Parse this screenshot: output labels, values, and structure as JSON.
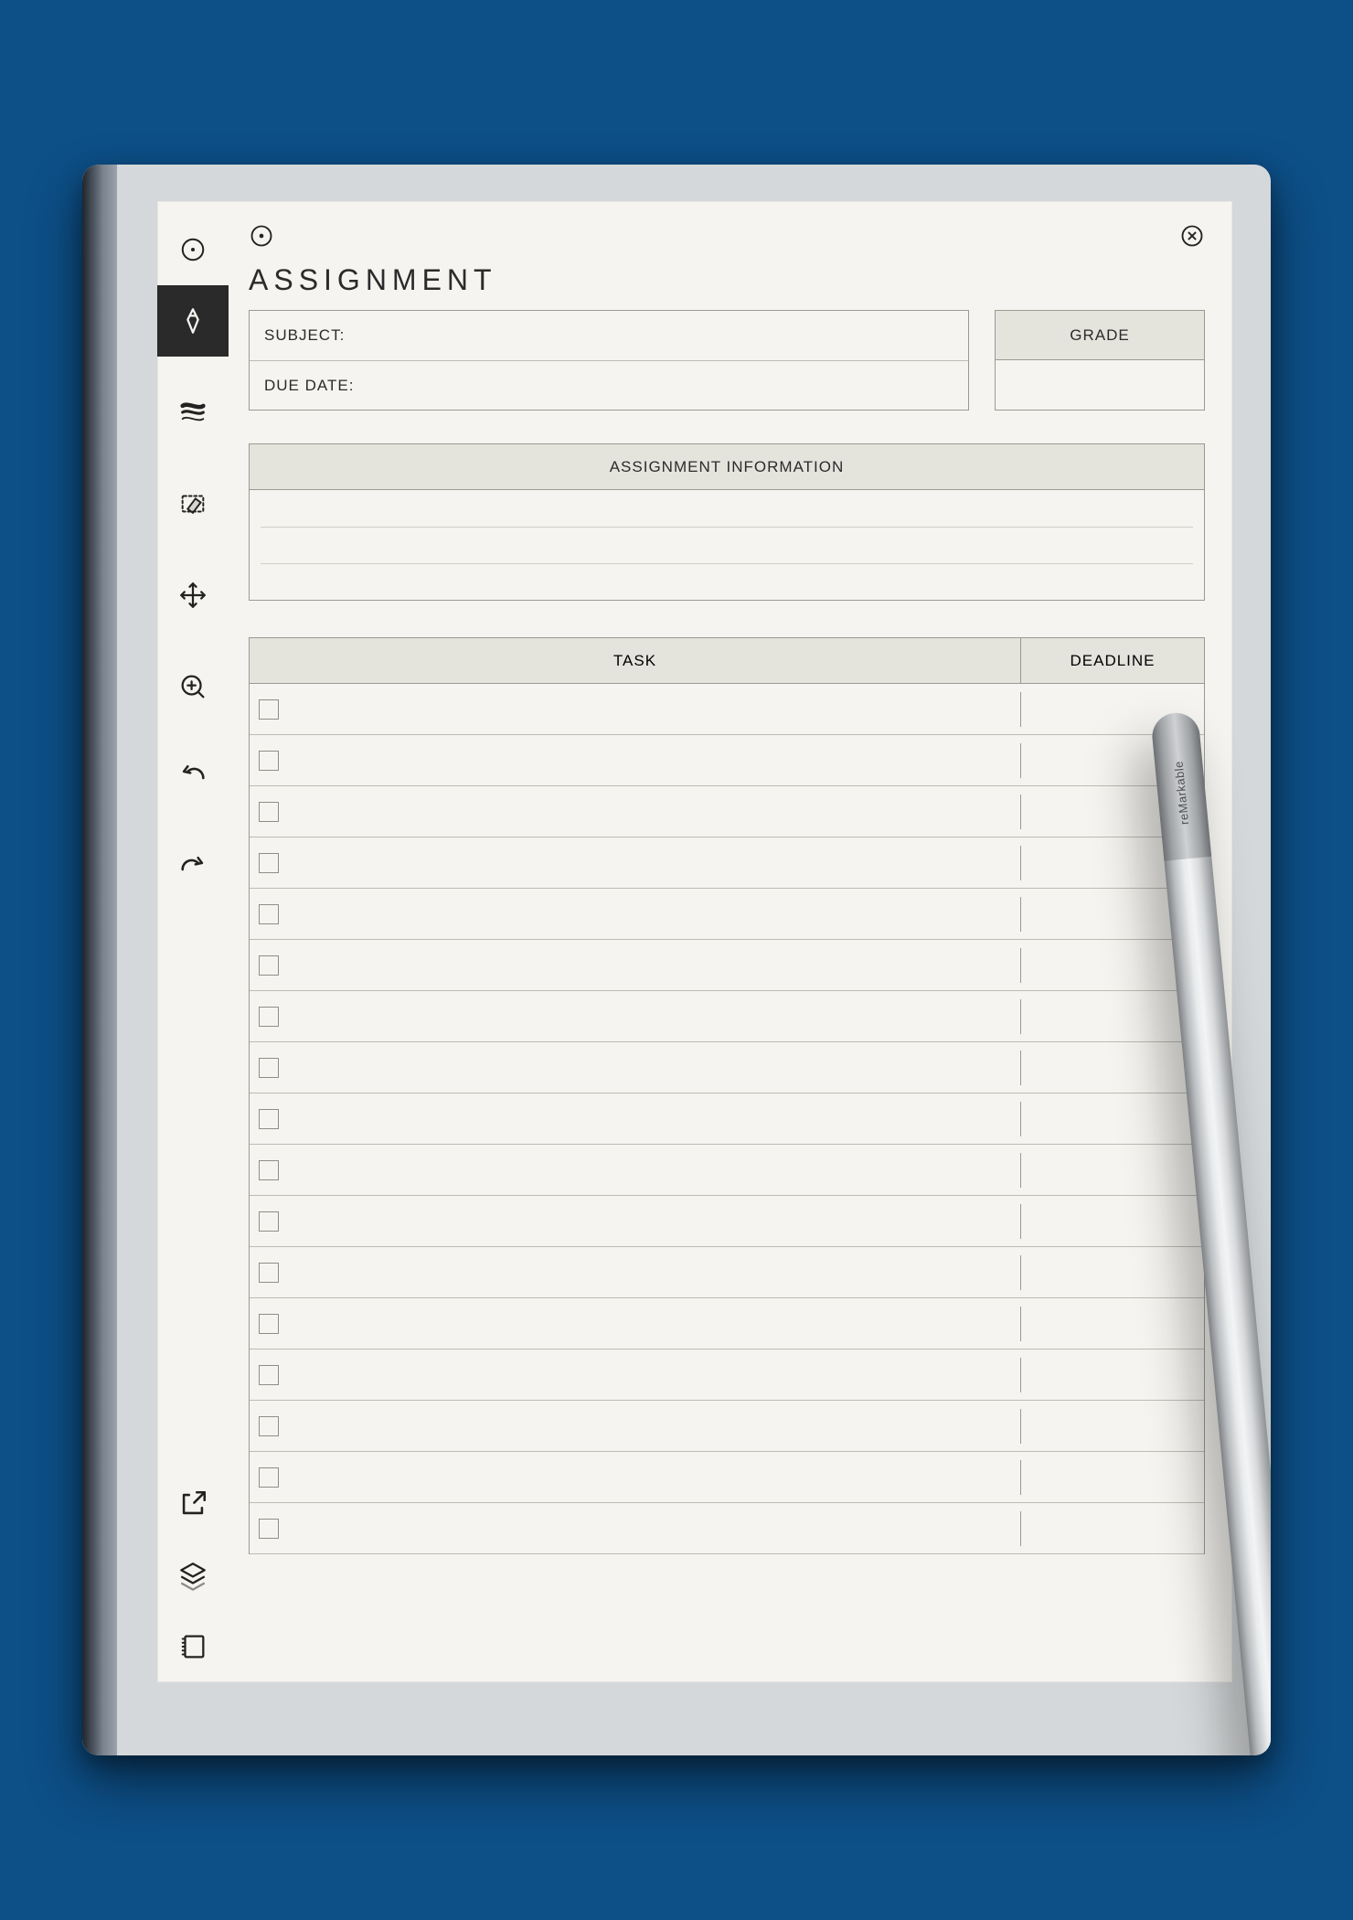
{
  "title": "ASSIGNMENT",
  "fields": {
    "subject_label": "SUBJECT:",
    "due_date_label": "DUE DATE:",
    "grade_label": "GRADE"
  },
  "info": {
    "header": "ASSIGNMENT INFORMATION"
  },
  "task_table": {
    "col_task": "TASK",
    "col_deadline": "DEADLINE",
    "row_count": 17
  },
  "pen": {
    "brand": "reMarkable"
  },
  "toolbar": {
    "items": [
      {
        "name": "menu-dot-icon",
        "active": false
      },
      {
        "name": "pen-tool-icon",
        "active": true
      },
      {
        "name": "stroke-width-icon",
        "active": false
      },
      {
        "name": "eraser-icon",
        "active": false
      },
      {
        "name": "move-icon",
        "active": false
      },
      {
        "name": "zoom-in-icon",
        "active": false
      },
      {
        "name": "undo-icon",
        "active": false
      },
      {
        "name": "redo-icon",
        "active": false
      }
    ],
    "bottom_items": [
      {
        "name": "share-icon"
      },
      {
        "name": "layers-icon"
      },
      {
        "name": "notebook-icon"
      }
    ]
  },
  "top_icons": {
    "left": "record-icon",
    "right": "close-icon"
  }
}
